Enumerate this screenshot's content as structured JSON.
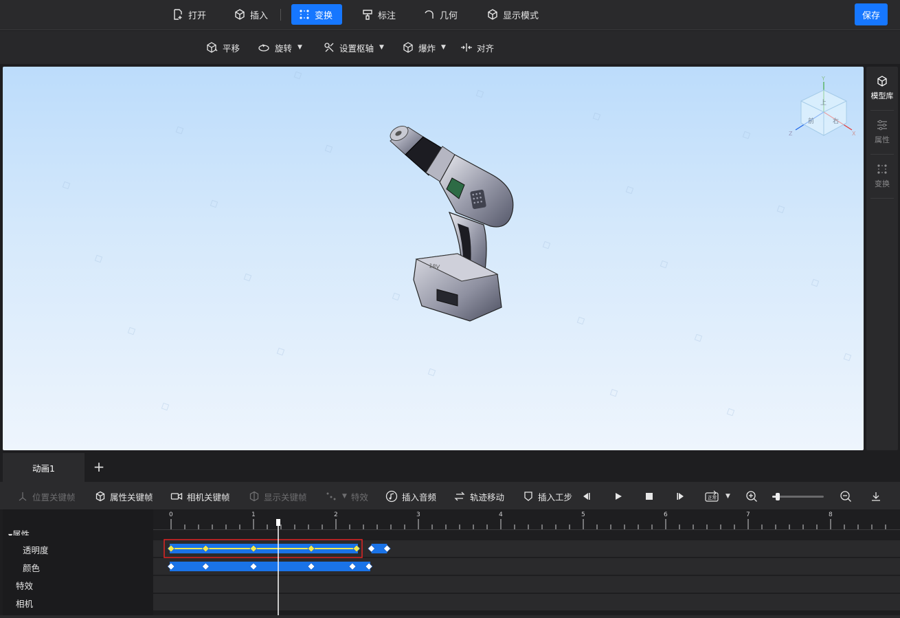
{
  "toolbar": {
    "open_label": "打开",
    "insert_label": "插入",
    "transform_label": "变换",
    "annotate_label": "标注",
    "geometry_label": "几何",
    "display_mode_label": "显示模式",
    "save_label": "保存"
  },
  "subtoolbar": {
    "translate_label": "平移",
    "rotate_label": "旋转",
    "set_pivot_label": "设置枢轴",
    "explode_label": "爆炸",
    "align_label": "对齐"
  },
  "right_panel": {
    "model_library_label": "模型库",
    "properties_label": "属性",
    "transform_label": "变换"
  },
  "viewcube": {
    "x_label": "X",
    "y_label": "Y",
    "z_label": "Z",
    "face_front": "前",
    "face_right": "右",
    "face_top": "上"
  },
  "model": {
    "battery_label": "18V"
  },
  "animation": {
    "tab_label": "动画1",
    "add_tab": "+",
    "toolbar": {
      "position_keyframe": "位置关键帧",
      "property_keyframe": "属性关键帧",
      "camera_keyframe": "相机关键帧",
      "display_keyframe": "显示关键帧",
      "effects": "特效",
      "insert_audio": "插入音频",
      "track_move": "轨迹移动",
      "insert_step": "插入工步",
      "speed_badge": "正常"
    },
    "zoom_level": 0.1,
    "tracks": {
      "group_label": "属性",
      "transparency_label": "透明度",
      "color_label": "颜色",
      "effects_label": "特效",
      "camera_label": "相机"
    },
    "ruler": {
      "tick_labels": [
        "0",
        "1",
        "2",
        "3",
        "4",
        "5",
        "6",
        "7",
        "8"
      ]
    },
    "playhead_time": 1.3,
    "keyframes": {
      "transparency": [
        0,
        0.42,
        1.0,
        1.7,
        2.25,
        2.43,
        2.62
      ],
      "color": [
        0,
        0.42,
        1.0,
        1.7,
        2.2,
        2.4
      ]
    },
    "selected_range": [
      0,
      2.25
    ]
  }
}
